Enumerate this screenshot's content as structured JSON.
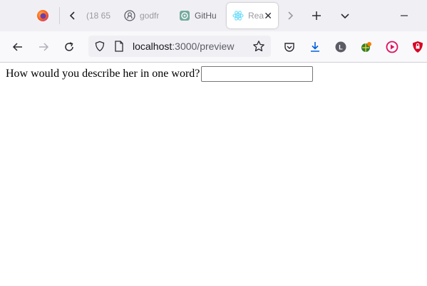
{
  "browser": {
    "tabs": [
      {
        "label": "(18 65",
        "icon": "generic-page-icon",
        "state": "muted"
      },
      {
        "label": "godfr",
        "icon": "github-icon",
        "state": "muted"
      },
      {
        "label": "GitHu",
        "icon": "chatgpt-icon",
        "state": "normal"
      },
      {
        "label": "Rea",
        "icon": "react-icon",
        "state": "active"
      }
    ],
    "address": {
      "host": "localhost",
      "rest": ":3000/preview"
    },
    "colors": {
      "tabbar_bg": "#f0f0f4",
      "navbar_bg": "#f9f9fb",
      "download_blue": "#0060df",
      "react_cyan": "#61dafb",
      "shield_red": "#d70022"
    }
  },
  "page": {
    "question": "How would you describe her in one word?",
    "answer_value": ""
  }
}
